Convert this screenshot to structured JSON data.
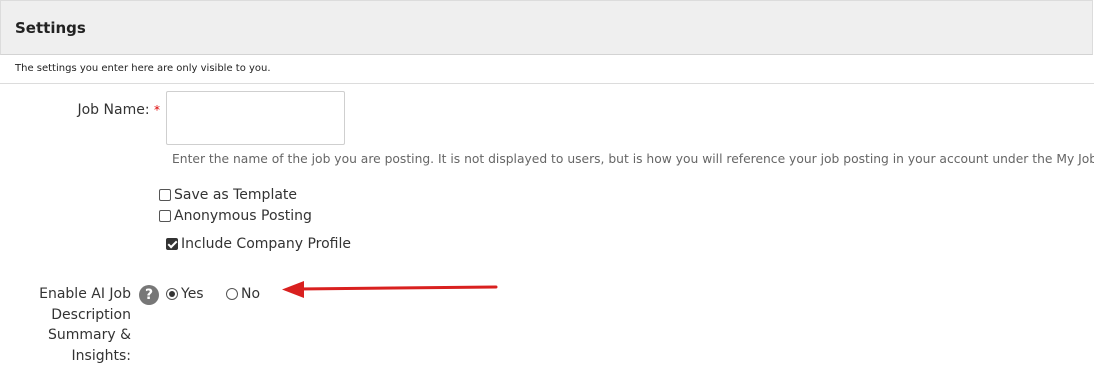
{
  "panel": {
    "title": "Settings",
    "note": "The settings you enter here are only visible to you."
  },
  "job_name": {
    "label": "Job Name:",
    "required_mark": "*",
    "value": "",
    "help": "Enter the name of the job you are posting. It is not displayed to users, but is how you will reference your job posting in your account under the My Jobs tab."
  },
  "options": [
    {
      "label": "Save as Template",
      "checked": false
    },
    {
      "label": "Anonymous Posting",
      "checked": false
    },
    {
      "label": "Include Company Profile",
      "checked": true
    }
  ],
  "ai_setting": {
    "label": "Enable AI Job Description Summary & Insights:",
    "help_glyph": "?",
    "yes_label": "Yes",
    "no_label": "No",
    "selected": "Yes"
  },
  "annotation": {
    "arrow_color": "#d9201f"
  }
}
